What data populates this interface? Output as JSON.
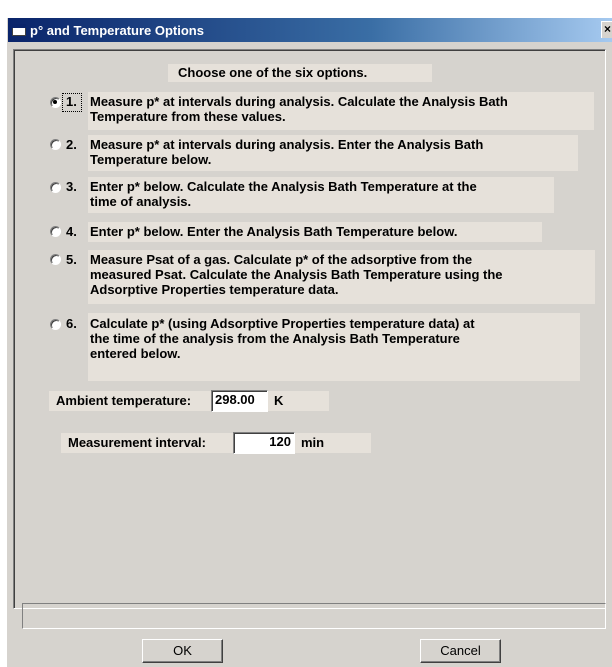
{
  "window": {
    "title": "p° and Temperature Options",
    "close_glyph": "×"
  },
  "prompt": "Choose one of the six options.",
  "options": [
    {
      "number": "1.",
      "lines": [
        "Measure p* at intervals during analysis.  Calculate the Analysis Bath",
        "Temperature from these values."
      ],
      "selected": true
    },
    {
      "number": "2.",
      "lines": [
        "Measure p* at intervals during analysis.  Enter the Analysis Bath",
        "Temperature below."
      ],
      "selected": false
    },
    {
      "number": "3.",
      "lines": [
        "Enter p* below.  Calculate the Analysis Bath Temperature at the",
        "time of analysis."
      ],
      "selected": false
    },
    {
      "number": "4.",
      "lines": [
        "Enter p* below.  Enter the Analysis Bath Temperature below."
      ],
      "selected": false
    },
    {
      "number": "5.",
      "lines": [
        "Measure Psat of a gas.  Calculate p* of the adsorptive from the",
        "measured Psat.  Calculate the Analysis Bath Temperature using the",
        "Adsorptive Properties temperature data."
      ],
      "selected": false
    },
    {
      "number": "6.",
      "lines": [
        "Calculate p* (using Adsorptive Properties temperature data) at",
        "the time of the analysis from the Analysis Bath Temperature",
        "entered below."
      ],
      "selected": false
    }
  ],
  "ambient": {
    "label": "Ambient temperature:",
    "value": "298.00",
    "unit": "K"
  },
  "interval": {
    "label": "Measurement interval:",
    "value": "120",
    "unit": "min"
  },
  "buttons": {
    "ok": "OK",
    "cancel": "Cancel"
  },
  "colors": {
    "dialog_bg": "#d6d3ce",
    "label_bg": "#e6e1da",
    "title_start": "#0a246a",
    "title_end": "#a6caf0"
  }
}
